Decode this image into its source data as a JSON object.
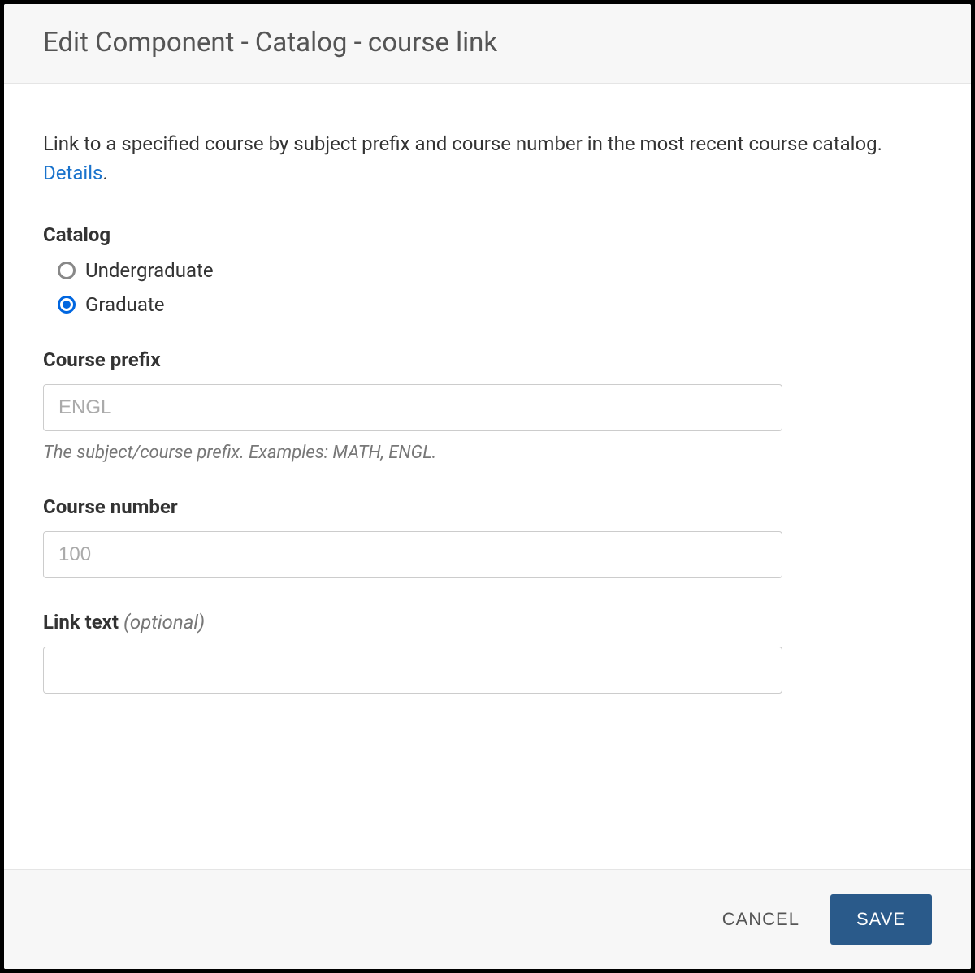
{
  "dialog": {
    "title": "Edit Component - Catalog - course link",
    "description_text": "Link to a specified course by subject prefix and course number in the most recent course catalog.  ",
    "details_link": "Details",
    "description_suffix": "."
  },
  "catalog": {
    "label": "Catalog",
    "options": [
      {
        "label": "Undergraduate",
        "selected": false
      },
      {
        "label": "Graduate",
        "selected": true
      }
    ]
  },
  "course_prefix": {
    "label": "Course prefix",
    "placeholder": "ENGL",
    "value": "",
    "help": "The subject/course prefix. Examples: MATH, ENGL."
  },
  "course_number": {
    "label": "Course number",
    "placeholder": "100",
    "value": ""
  },
  "link_text": {
    "label": "Link text ",
    "optional": "(optional)",
    "value": ""
  },
  "footer": {
    "cancel": "CANCEL",
    "save": "SAVE"
  }
}
